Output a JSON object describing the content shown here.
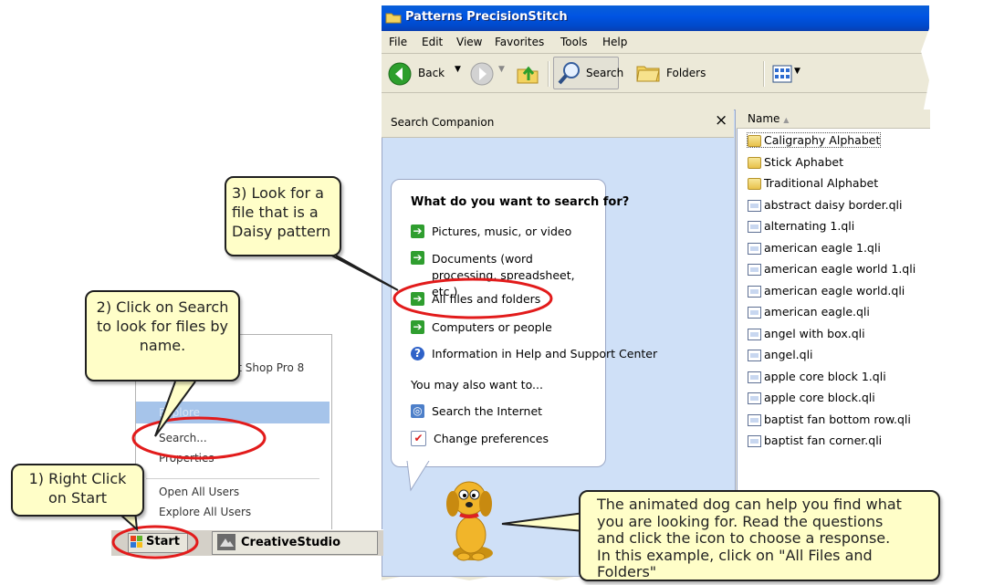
{
  "window": {
    "title": "Patterns PrecisionStitch",
    "menu": [
      "File",
      "Edit",
      "View",
      "Favorites",
      "Tools",
      "Help"
    ],
    "toolbar": {
      "back_label": "Back",
      "search_label": "Search",
      "folders_label": "Folders"
    }
  },
  "search_companion": {
    "title": "Search Companion",
    "close_glyph": "×",
    "question": "What do you want to search for?",
    "options": [
      "Pictures, music, or video",
      "Documents (word processing, spreadsheet, etc.)",
      "All files and folders",
      "Computers or people",
      "Information in Help and Support Center"
    ],
    "also_label": "You may also want to...",
    "also_options": [
      "Search the Internet",
      "Change preferences"
    ]
  },
  "file_list": {
    "column_name": "Name",
    "sort_glyph": "▲",
    "items": [
      {
        "name": "Caligraphy Alphabet",
        "type": "folder"
      },
      {
        "name": "Stick Aphabet",
        "type": "folder"
      },
      {
        "name": "Traditional Alphabet",
        "type": "folder"
      },
      {
        "name": "abstract daisy border.qli",
        "type": "file"
      },
      {
        "name": "alternating 1.qli",
        "type": "file"
      },
      {
        "name": "american eagle 1.qli",
        "type": "file"
      },
      {
        "name": "american eagle world 1.qli",
        "type": "file"
      },
      {
        "name": "american eagle world.qli",
        "type": "file"
      },
      {
        "name": "american eagle.qli",
        "type": "file"
      },
      {
        "name": "angel with box.qli",
        "type": "file"
      },
      {
        "name": "angel.qli",
        "type": "file"
      },
      {
        "name": "apple core block 1.qli",
        "type": "file"
      },
      {
        "name": "apple core block.qli",
        "type": "file"
      },
      {
        "name": "baptist fan bottom row.qli",
        "type": "file"
      },
      {
        "name": "baptist fan corner.qli",
        "type": "file"
      }
    ]
  },
  "start_menu": {
    "items": [
      "... Paint Shop Pro 8",
      "Explore",
      "Search...",
      "Properties",
      "Open All Users",
      "Explore All Users"
    ]
  },
  "taskbar": {
    "start_label": "Start",
    "creative_studio_label": "CreativeStudio"
  },
  "callouts": {
    "step1": "1) Right Click on Start",
    "step2": "2) Click on Search to look for files by name.",
    "step3": "3) Look for a file that is a Daisy pattern",
    "dog_lines": [
      "The animated dog can help you find what",
      "you are looking for. Read the questions",
      "and click the icon to choose a response.",
      "In this example, click on \"All Files and",
      "Folders\""
    ]
  },
  "colors": {
    "callout_fill": "#fffec8",
    "highlight_ring": "#e21b1b",
    "titlebar": "#0054e3",
    "pane_bg": "#cfe0f7"
  }
}
